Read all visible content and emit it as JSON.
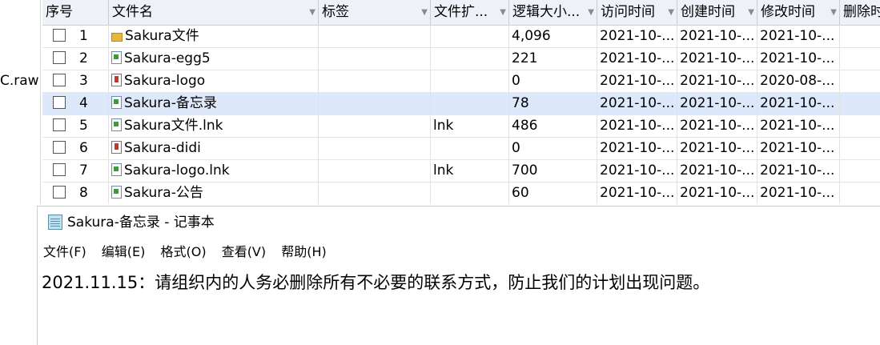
{
  "left_pane": {
    "cut_text": "C.raw"
  },
  "columns": [
    "序号",
    "文件名",
    "标签",
    "文件扩...",
    "逻辑大小...",
    "访问时间",
    "创建时间",
    "修改时间",
    "删除时"
  ],
  "rows": [
    {
      "num": "1",
      "name": "Sakura文件",
      "icon": "folder-icon",
      "tag": "",
      "ext": "",
      "size": "4,096",
      "access": "2021-10-...",
      "create": "2021-10-...",
      "modify": "2021-10-...",
      "selected": false
    },
    {
      "num": "2",
      "name": "Sakura-egg5",
      "icon": "file-icon",
      "tag": "",
      "ext": "",
      "size": "221",
      "access": "2021-10-...",
      "create": "2021-10-...",
      "modify": "2021-10-...",
      "selected": false
    },
    {
      "num": "3",
      "name": "Sakura-logo",
      "icon": "image-file-icon",
      "tag": "",
      "ext": "",
      "size": "0",
      "access": "2021-10-...",
      "create": "2021-10-...",
      "modify": "2020-08-...",
      "selected": false
    },
    {
      "num": "4",
      "name": "Sakura-备忘录",
      "icon": "file-icon",
      "tag": "",
      "ext": "",
      "size": "78",
      "access": "2021-10-...",
      "create": "2021-10-...",
      "modify": "2021-10-...",
      "selected": true
    },
    {
      "num": "5",
      "name": "Sakura文件.lnk",
      "icon": "file-icon",
      "tag": "",
      "ext": "lnk",
      "size": "486",
      "access": "2021-10-...",
      "create": "2021-10-...",
      "modify": "2021-10-...",
      "selected": false
    },
    {
      "num": "6",
      "name": "Sakura-didi",
      "icon": "image-file-icon",
      "tag": "",
      "ext": "",
      "size": "0",
      "access": "2021-10-...",
      "create": "2021-10-...",
      "modify": "2021-10-...",
      "selected": false
    },
    {
      "num": "7",
      "name": "Sakura-logo.lnk",
      "icon": "file-icon",
      "tag": "",
      "ext": "lnk",
      "size": "700",
      "access": "2021-10-...",
      "create": "2021-10-...",
      "modify": "2021-10-...",
      "selected": false
    },
    {
      "num": "8",
      "name": "Sakura-公告",
      "icon": "file-icon",
      "tag": "",
      "ext": "",
      "size": "60",
      "access": "2021-10-...",
      "create": "2021-10-...",
      "modify": "2021-10-...",
      "selected": false
    }
  ],
  "notepad": {
    "title": "Sakura-备忘录 - 记事本",
    "menu": [
      "文件(F)",
      "编辑(E)",
      "格式(O)",
      "查看(V)",
      "帮助(H)"
    ],
    "content": "2021.11.15：请组织内的人务必删除所有不必要的联系方式，防止我们的计划出现问题。"
  },
  "colors": {
    "header_bg": "#eef1f7",
    "selected_row": "#dde8fb"
  }
}
